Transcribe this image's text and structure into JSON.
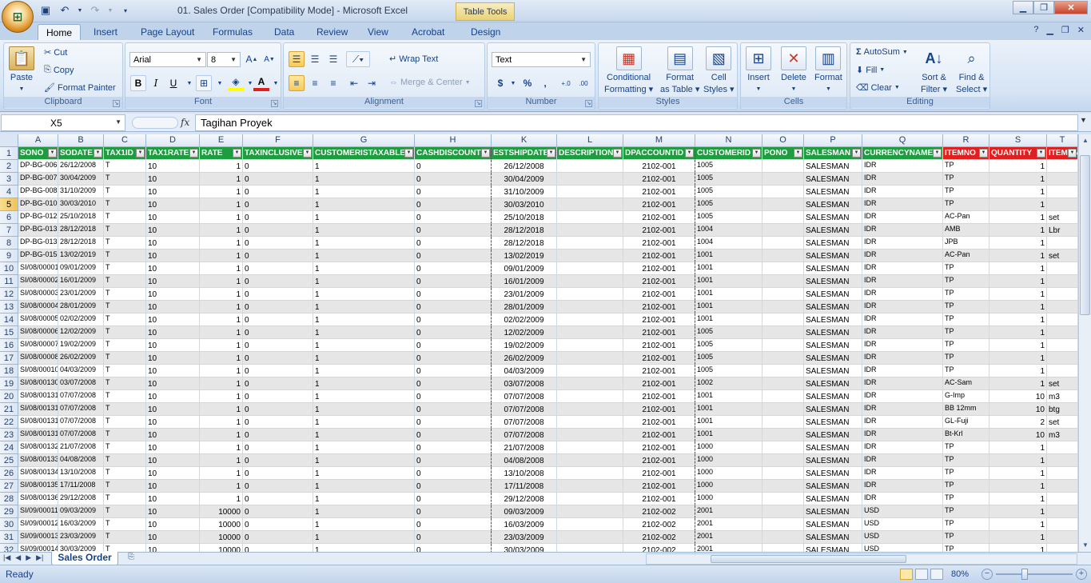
{
  "window": {
    "title": "01. Sales Order  [Compatibility Mode] - Microsoft Excel",
    "contextual_tab": "Table Tools"
  },
  "ribbon_tabs": [
    "Home",
    "Insert",
    "Page Layout",
    "Formulas",
    "Data",
    "Review",
    "View",
    "Acrobat",
    "Design"
  ],
  "active_tab": "Home",
  "clipboard": {
    "paste": "Paste",
    "cut": "Cut",
    "copy": "Copy",
    "format_painter": "Format Painter",
    "label": "Clipboard"
  },
  "font": {
    "name": "Arial",
    "size": "8",
    "bold": "B",
    "italic": "I",
    "underline": "U",
    "label": "Font"
  },
  "alignment": {
    "wrap": "Wrap Text",
    "merge": "Merge & Center",
    "label": "Alignment"
  },
  "number": {
    "format": "Text",
    "currency": "$",
    "percent": "%",
    "comma": ",",
    "inc": "+.0",
    "dec": ".00",
    "label": "Number"
  },
  "styles": {
    "cond_1": "Conditional",
    "cond_2": "Formatting",
    "fmt_1": "Format",
    "fmt_2": "as Table",
    "cell_1": "Cell",
    "cell_2": "Styles",
    "label": "Styles"
  },
  "cells": {
    "insert": "Insert",
    "delete": "Delete",
    "format": "Format",
    "label": "Cells"
  },
  "editing": {
    "autosum": "AutoSum",
    "fill": "Fill",
    "clear": "Clear",
    "sort_1": "Sort &",
    "sort_2": "Filter",
    "find_1": "Find &",
    "find_2": "Select",
    "label": "Editing"
  },
  "formula_bar": {
    "name_box": "X5",
    "fx": "fx",
    "formula": "Tagihan Proyek"
  },
  "columns": [
    "A",
    "B",
    "C",
    "D",
    "E",
    "F",
    "G",
    "H",
    "K",
    "L",
    "M",
    "N",
    "O",
    "P",
    "Q",
    "R",
    "S",
    "T"
  ],
  "headers": [
    "SONO",
    "SODATE",
    "TAX1ID",
    "TAX1RATE",
    "RATE",
    "TAXINCLUSIVE",
    "CUSTOMERISTAXABLE",
    "CASHDISCOUNT",
    "ESTSHIPDATE",
    "DESCRIPTION",
    "DPACCOUNTID",
    "CUSTOMERID",
    "PONO",
    "SALESMAN",
    "CURRENCYNAME",
    "ITEMNO",
    "QUANTITY",
    "ITEMUNIT"
  ],
  "rows": [
    [
      "DP-BG-006",
      "26/12/2008",
      "T",
      "10",
      "1",
      "0",
      "1",
      "0",
      "26/12/2008",
      "",
      "2102-001",
      "1005",
      "",
      "SALESMAN",
      "IDR",
      "TP",
      "1",
      ""
    ],
    [
      "DP-BG-007",
      "30/04/2009",
      "T",
      "10",
      "1",
      "0",
      "1",
      "0",
      "30/04/2009",
      "",
      "2102-001",
      "1005",
      "",
      "SALESMAN",
      "IDR",
      "TP",
      "1",
      ""
    ],
    [
      "DP-BG-008",
      "31/10/2009",
      "T",
      "10",
      "1",
      "0",
      "1",
      "0",
      "31/10/2009",
      "",
      "2102-001",
      "1005",
      "",
      "SALESMAN",
      "IDR",
      "TP",
      "1",
      ""
    ],
    [
      "DP-BG-010",
      "30/03/2010",
      "T",
      "10",
      "1",
      "0",
      "1",
      "0",
      "30/03/2010",
      "",
      "2102-001",
      "1005",
      "",
      "SALESMAN",
      "IDR",
      "TP",
      "1",
      ""
    ],
    [
      "DP-BG-012",
      "25/10/2018",
      "T",
      "10",
      "1",
      "0",
      "1",
      "0",
      "25/10/2018",
      "",
      "2102-001",
      "1005",
      "",
      "SALESMAN",
      "IDR",
      "AC-Pan",
      "1",
      "set"
    ],
    [
      "DP-BG-013",
      "28/12/2018",
      "T",
      "10",
      "1",
      "0",
      "1",
      "0",
      "28/12/2018",
      "",
      "2102-001",
      "1004",
      "",
      "SALESMAN",
      "IDR",
      "AMB",
      "1",
      "Lbr"
    ],
    [
      "DP-BG-013",
      "28/12/2018",
      "T",
      "10",
      "1",
      "0",
      "1",
      "0",
      "28/12/2018",
      "",
      "2102-001",
      "1004",
      "",
      "SALESMAN",
      "IDR",
      "JPB",
      "1",
      ""
    ],
    [
      "DP-BG-015",
      "13/02/2019",
      "T",
      "10",
      "1",
      "0",
      "1",
      "0",
      "13/02/2019",
      "",
      "2102-001",
      "1001",
      "",
      "SALESMAN",
      "IDR",
      "AC-Pan",
      "1",
      "set"
    ],
    [
      "SI/08/00001",
      "09/01/2009",
      "T",
      "10",
      "1",
      "0",
      "1",
      "0",
      "09/01/2009",
      "",
      "2102-001",
      "1001",
      "",
      "SALESMAN",
      "IDR",
      "TP",
      "1",
      ""
    ],
    [
      "SI/08/00002",
      "16/01/2009",
      "T",
      "10",
      "1",
      "0",
      "1",
      "0",
      "16/01/2009",
      "",
      "2102-001",
      "1001",
      "",
      "SALESMAN",
      "IDR",
      "TP",
      "1",
      ""
    ],
    [
      "SI/08/00003",
      "23/01/2009",
      "T",
      "10",
      "1",
      "0",
      "1",
      "0",
      "23/01/2009",
      "",
      "2102-001",
      "1001",
      "",
      "SALESMAN",
      "IDR",
      "TP",
      "1",
      ""
    ],
    [
      "SI/08/00004",
      "28/01/2009",
      "T",
      "10",
      "1",
      "0",
      "1",
      "0",
      "28/01/2009",
      "",
      "2102-001",
      "1001",
      "",
      "SALESMAN",
      "IDR",
      "TP",
      "1",
      ""
    ],
    [
      "SI/08/00005",
      "02/02/2009",
      "T",
      "10",
      "1",
      "0",
      "1",
      "0",
      "02/02/2009",
      "",
      "2102-001",
      "1001",
      "",
      "SALESMAN",
      "IDR",
      "TP",
      "1",
      ""
    ],
    [
      "SI/08/00006",
      "12/02/2009",
      "T",
      "10",
      "1",
      "0",
      "1",
      "0",
      "12/02/2009",
      "",
      "2102-001",
      "1005",
      "",
      "SALESMAN",
      "IDR",
      "TP",
      "1",
      ""
    ],
    [
      "SI/08/00007",
      "19/02/2009",
      "T",
      "10",
      "1",
      "0",
      "1",
      "0",
      "19/02/2009",
      "",
      "2102-001",
      "1005",
      "",
      "SALESMAN",
      "IDR",
      "TP",
      "1",
      ""
    ],
    [
      "SI/08/00008",
      "26/02/2009",
      "T",
      "10",
      "1",
      "0",
      "1",
      "0",
      "26/02/2009",
      "",
      "2102-001",
      "1005",
      "",
      "SALESMAN",
      "IDR",
      "TP",
      "1",
      ""
    ],
    [
      "SI/08/00010",
      "04/03/2009",
      "T",
      "10",
      "1",
      "0",
      "1",
      "0",
      "04/03/2009",
      "",
      "2102-001",
      "1005",
      "",
      "SALESMAN",
      "IDR",
      "TP",
      "1",
      ""
    ],
    [
      "SI/08/00130",
      "03/07/2008",
      "T",
      "10",
      "1",
      "0",
      "1",
      "0",
      "03/07/2008",
      "",
      "2102-001",
      "1002",
      "",
      "SALESMAN",
      "IDR",
      "AC-Sam",
      "1",
      "set"
    ],
    [
      "SI/08/00131",
      "07/07/2008",
      "T",
      "10",
      "1",
      "0",
      "1",
      "0",
      "07/07/2008",
      "",
      "2102-001",
      "1001",
      "",
      "SALESMAN",
      "IDR",
      "G-Imp",
      "10",
      "m3"
    ],
    [
      "SI/08/00131",
      "07/07/2008",
      "T",
      "10",
      "1",
      "0",
      "1",
      "0",
      "07/07/2008",
      "",
      "2102-001",
      "1001",
      "",
      "SALESMAN",
      "IDR",
      "BB 12mm",
      "10",
      "btg"
    ],
    [
      "SI/08/00131",
      "07/07/2008",
      "T",
      "10",
      "1",
      "0",
      "1",
      "0",
      "07/07/2008",
      "",
      "2102-001",
      "1001",
      "",
      "SALESMAN",
      "IDR",
      "GL-Fuji",
      "2",
      "set"
    ],
    [
      "SI/08/00131",
      "07/07/2008",
      "T",
      "10",
      "1",
      "0",
      "1",
      "0",
      "07/07/2008",
      "",
      "2102-001",
      "1001",
      "",
      "SALESMAN",
      "IDR",
      "Bt-Krl",
      "10",
      "m3"
    ],
    [
      "SI/08/00132",
      "21/07/2008",
      "T",
      "10",
      "1",
      "0",
      "1",
      "0",
      "21/07/2008",
      "",
      "2102-001",
      "1000",
      "",
      "SALESMAN",
      "IDR",
      "TP",
      "1",
      ""
    ],
    [
      "SI/08/00133",
      "04/08/2008",
      "T",
      "10",
      "1",
      "0",
      "1",
      "0",
      "04/08/2008",
      "",
      "2102-001",
      "1000",
      "",
      "SALESMAN",
      "IDR",
      "TP",
      "1",
      ""
    ],
    [
      "SI/08/00134",
      "13/10/2008",
      "T",
      "10",
      "1",
      "0",
      "1",
      "0",
      "13/10/2008",
      "",
      "2102-001",
      "1000",
      "",
      "SALESMAN",
      "IDR",
      "TP",
      "1",
      ""
    ],
    [
      "SI/08/00135",
      "17/11/2008",
      "T",
      "10",
      "1",
      "0",
      "1",
      "0",
      "17/11/2008",
      "",
      "2102-001",
      "1000",
      "",
      "SALESMAN",
      "IDR",
      "TP",
      "1",
      ""
    ],
    [
      "SI/08/00136",
      "29/12/2008",
      "T",
      "10",
      "1",
      "0",
      "1",
      "0",
      "29/12/2008",
      "",
      "2102-001",
      "1000",
      "",
      "SALESMAN",
      "IDR",
      "TP",
      "1",
      ""
    ],
    [
      "SI/09/00011",
      "09/03/2009",
      "T",
      "10",
      "10000",
      "0",
      "1",
      "0",
      "09/03/2009",
      "",
      "2102-002",
      "2001",
      "",
      "SALESMAN",
      "USD",
      "TP",
      "1",
      ""
    ],
    [
      "SI/09/00012",
      "16/03/2009",
      "T",
      "10",
      "10000",
      "0",
      "1",
      "0",
      "16/03/2009",
      "",
      "2102-002",
      "2001",
      "",
      "SALESMAN",
      "USD",
      "TP",
      "1",
      ""
    ],
    [
      "SI/09/00013",
      "23/03/2009",
      "T",
      "10",
      "10000",
      "0",
      "1",
      "0",
      "23/03/2009",
      "",
      "2102-002",
      "2001",
      "",
      "SALESMAN",
      "USD",
      "TP",
      "1",
      ""
    ],
    [
      "SI/09/00014",
      "30/03/2009",
      "T",
      "10",
      "10000",
      "0",
      "1",
      "0",
      "30/03/2009",
      "",
      "2102-002",
      "2001",
      "",
      "SALESMAN",
      "USD",
      "TP",
      "1",
      ""
    ]
  ],
  "sheet_tab": "Sales Order",
  "status": {
    "ready": "Ready",
    "zoom": "80%"
  }
}
